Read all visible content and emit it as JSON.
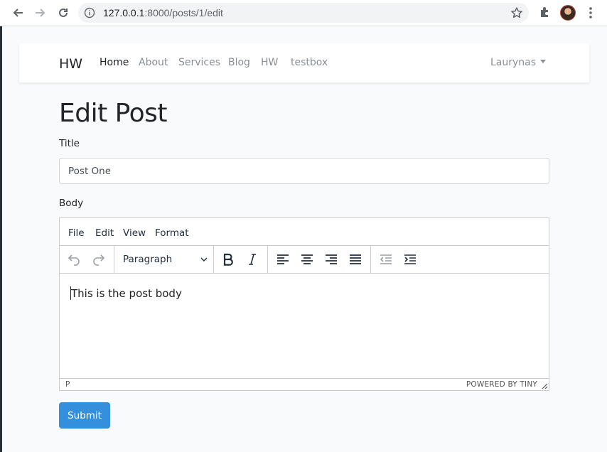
{
  "browser": {
    "url_host": "127.0.0.1",
    "url_rest": ":8000/posts/1/edit"
  },
  "navbar": {
    "brand": "HW",
    "links": [
      "Home",
      "About",
      "Services",
      "Blog",
      "HW",
      "testbox"
    ],
    "active_link": "Home",
    "user": "Laurynas"
  },
  "page": {
    "title": "Edit Post",
    "title_label": "Title",
    "title_value": "Post One",
    "body_label": "Body",
    "submit_label": "Submit"
  },
  "editor": {
    "menu": [
      "File",
      "Edit",
      "View",
      "Format"
    ],
    "block_format": "Paragraph",
    "toolbar_icons": [
      "undo-icon",
      "redo-icon",
      "bold-icon",
      "italic-icon",
      "align-left-icon",
      "align-center-icon",
      "align-right-icon",
      "align-justify-icon",
      "outdent-icon",
      "indent-icon"
    ],
    "content": "This is the post body",
    "status_path": "P",
    "branding": "POWERED BY TINY"
  },
  "colors": {
    "primary": "#3490dc",
    "background": "#f8fafc"
  }
}
